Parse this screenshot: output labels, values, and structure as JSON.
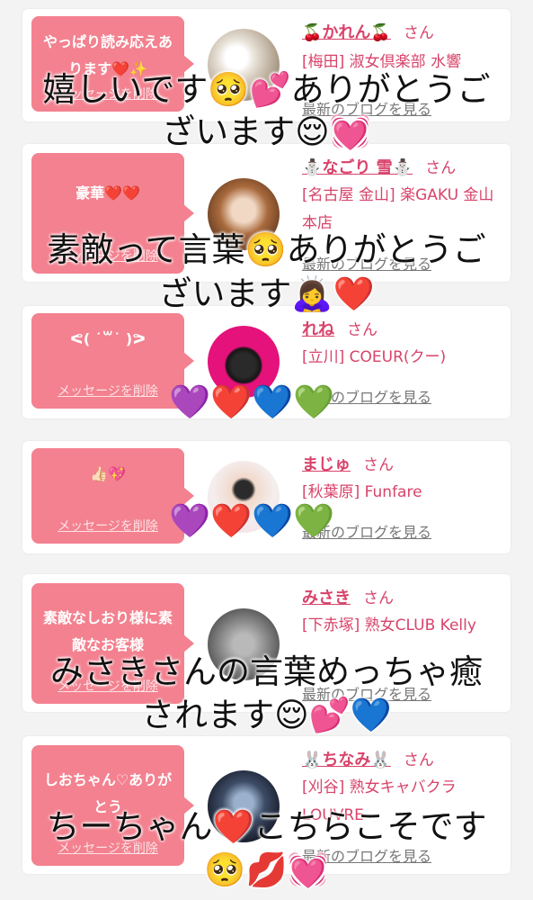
{
  "cards": [
    {
      "message": "やっぱり読み応えあります❤️✨",
      "delete_label": "メッセージを削除",
      "name": "🍒かれん🍒",
      "honorific": "さん",
      "shop": "[梅田] 淑女倶楽部 水響",
      "blog_link": "最新のブログを見る"
    },
    {
      "message": "豪華❤️❤️",
      "delete_label": "メッセージを削除",
      "name": "⛄なごり 雪⛄",
      "honorific": "さん",
      "shop": "[名古屋 金山] 楽GAKU 金山本店",
      "blog_link": "最新のブログを見る"
    },
    {
      "message": "ᕙ( ˙꒳˙ )ᕗ",
      "delete_label": "メッセージを削除",
      "name": "れね",
      "honorific": "さん",
      "shop": "[立川] COEUR(クー)",
      "blog_link": "最新のブログを見る"
    },
    {
      "message": "👍🏻💖",
      "delete_label": "メッセージを削除",
      "name": "まじゅ",
      "honorific": "さん",
      "shop": "[秋葉原] Funfare",
      "blog_link": "最新のブログを見る"
    },
    {
      "message": "素敵なしおり様に素敵なお客様",
      "delete_label": "メッセージを削除",
      "name": "みさき",
      "honorific": "さん",
      "shop": "[下赤塚] 熟女CLUB Kelly",
      "blog_link": "最新のブログを見る"
    },
    {
      "message": "しおちゃん♡ありがとう",
      "delete_label": "メッセージを削除",
      "name": "🐰ちなみ🐰",
      "honorific": "さん",
      "shop": "[刈谷] 熟女キャバクラ LOUVRE",
      "blog_link": "最新のブログを見る"
    }
  ],
  "overlays": [
    "嬉しいです🥺💕ありがとうご",
    "ざいます😌💓",
    "素敵って言葉🥺ありがとうご",
    "ざいます🙇‍♀️❤️",
    "💜❤️💙💚",
    "💜❤️💙💚",
    "みさきさんの言葉めっちゃ癒",
    "されます😌💕💙",
    "ちーちゃん❤️こちらこそです",
    "🥺💋💓"
  ],
  "colors": {
    "bubble": "#f3818f",
    "name": "#d8436a",
    "background": "#f3f3f4"
  },
  "icons": [
    "avatar-flower-portrait",
    "avatar-brown-hair",
    "avatar-pink-circle-girl",
    "avatar-white-room-girl",
    "avatar-grey-hair",
    "avatar-dark-portrait"
  ]
}
